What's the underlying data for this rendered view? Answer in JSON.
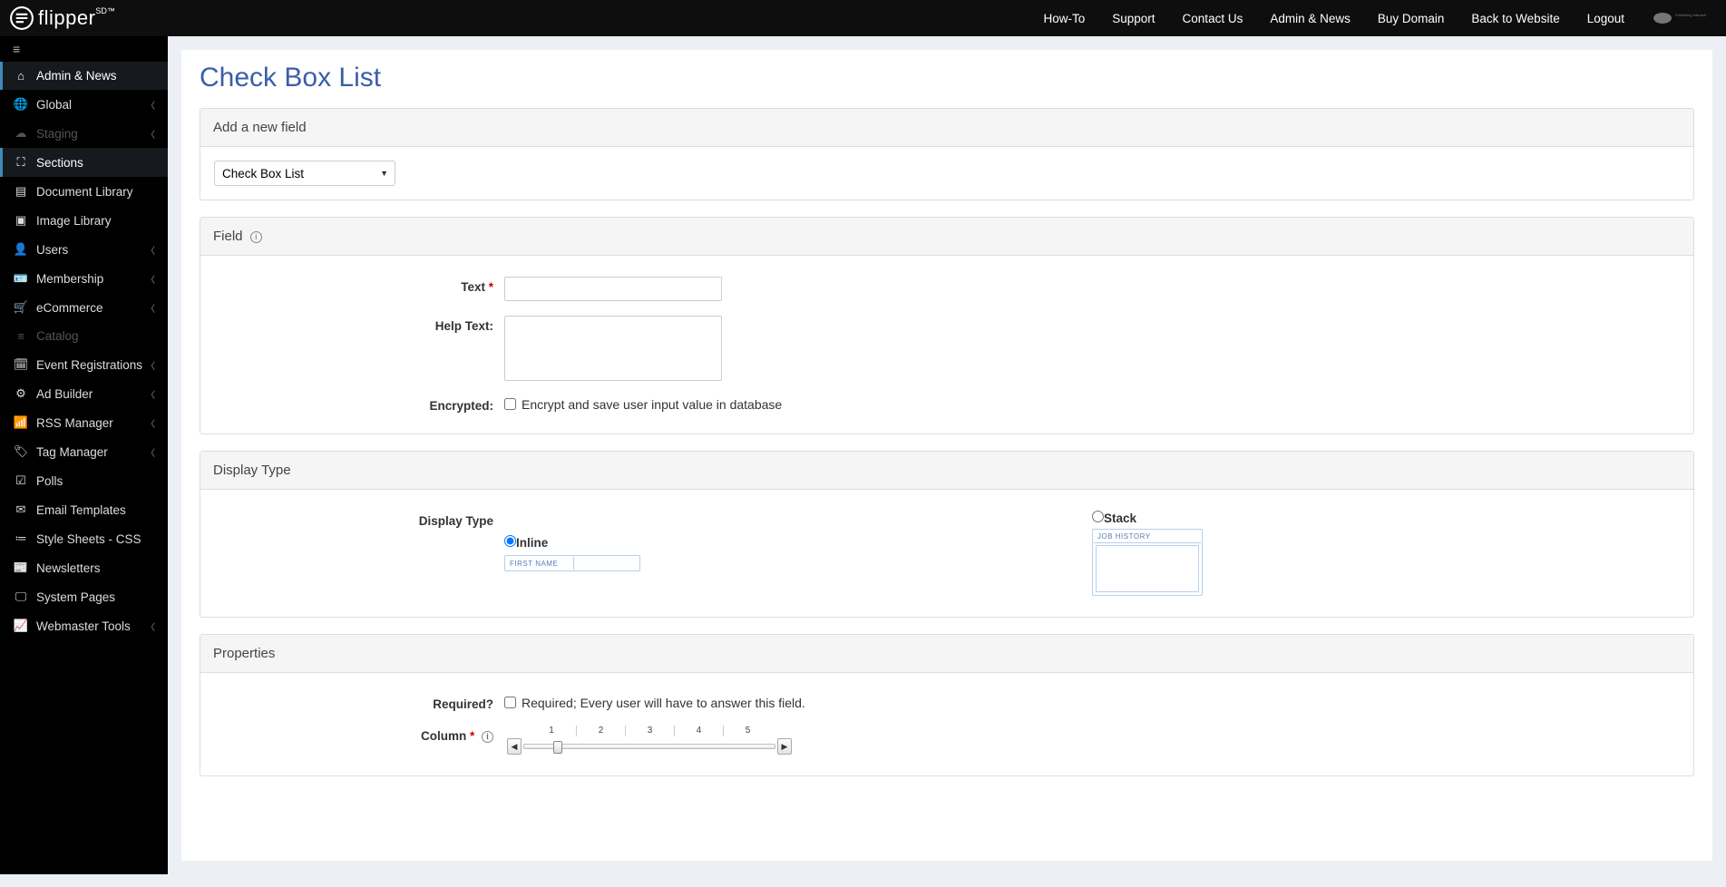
{
  "topnav": {
    "brand": "flipper",
    "brand_sup": "SD™",
    "links": [
      "How-To",
      "Support",
      "Contact Us",
      "Admin & News",
      "Buy Domain",
      "Back to Website",
      "Logout"
    ],
    "logo2_text": "Publishing Interactive, inc."
  },
  "sidebar": {
    "items": [
      {
        "icon": "home",
        "label": "Admin & News",
        "active": true
      },
      {
        "icon": "globe",
        "label": "Global",
        "chev": true
      },
      {
        "icon": "cloud",
        "label": "Staging",
        "chev": true,
        "disabled": true
      },
      {
        "icon": "th",
        "label": "Sections",
        "active": true
      },
      {
        "icon": "file",
        "label": "Document Library"
      },
      {
        "icon": "image",
        "label": "Image Library"
      },
      {
        "icon": "user",
        "label": "Users",
        "chev": true
      },
      {
        "icon": "id",
        "label": "Membership",
        "chev": true
      },
      {
        "icon": "cart",
        "label": "eCommerce",
        "chev": true
      },
      {
        "icon": "list",
        "label": "Catalog",
        "disabled": true
      },
      {
        "icon": "cal",
        "label": "Event Registrations",
        "chev": true
      },
      {
        "icon": "cogs",
        "label": "Ad Builder",
        "chev": true
      },
      {
        "icon": "rss",
        "label": "RSS Manager",
        "chev": true
      },
      {
        "icon": "tag",
        "label": "Tag Manager",
        "chev": true
      },
      {
        "icon": "check",
        "label": "Polls"
      },
      {
        "icon": "mail",
        "label": "Email Templates"
      },
      {
        "icon": "css",
        "label": "Style Sheets - CSS"
      },
      {
        "icon": "news",
        "label": "Newsletters"
      },
      {
        "icon": "sys",
        "label": "System Pages"
      },
      {
        "icon": "chart",
        "label": "Webmaster Tools",
        "chev": true
      }
    ]
  },
  "page": {
    "title": "Check Box List",
    "add_panel": {
      "head": "Add a new field",
      "selected": "Check Box List"
    },
    "field_panel": {
      "head": "Field",
      "text_label": "Text",
      "help_label": "Help Text:",
      "encrypted_label": "Encrypted:",
      "encrypted_text": "Encrypt and save user input value in database"
    },
    "display_panel": {
      "head": "Display Type",
      "label": "Display Type",
      "inline": "Inline",
      "stack": "Stack",
      "inline_preview": "FIRST NAME",
      "stack_preview": "JOB HISTORY"
    },
    "props_panel": {
      "head": "Properties",
      "required_label": "Required?",
      "required_text": "Required; Every user will have to answer this field.",
      "column_label": "Column",
      "ticks": [
        "1",
        "2",
        "3",
        "4",
        "5"
      ]
    }
  }
}
